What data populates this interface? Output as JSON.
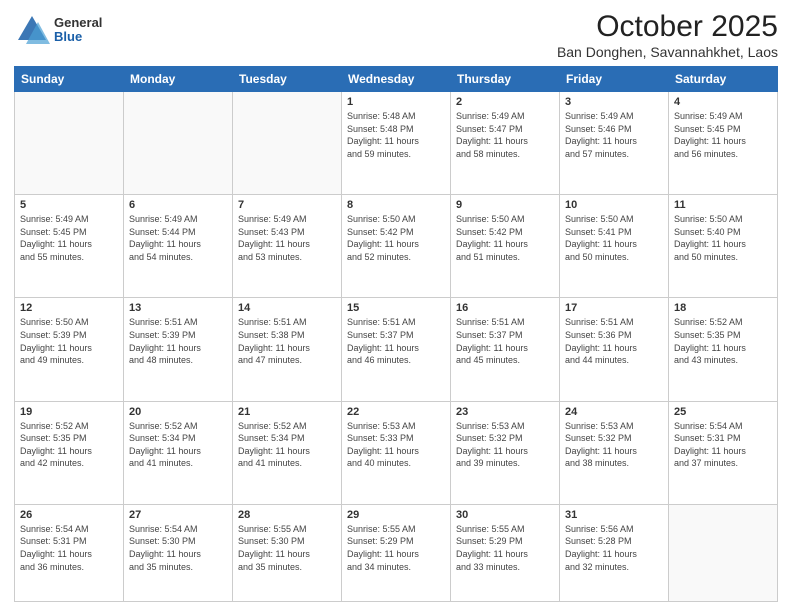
{
  "header": {
    "logo_general": "General",
    "logo_blue": "Blue",
    "title": "October 2025",
    "location": "Ban Donghen, Savannahkhet, Laos"
  },
  "weekdays": [
    "Sunday",
    "Monday",
    "Tuesday",
    "Wednesday",
    "Thursday",
    "Friday",
    "Saturday"
  ],
  "weeks": [
    [
      {
        "num": "",
        "info": ""
      },
      {
        "num": "",
        "info": ""
      },
      {
        "num": "",
        "info": ""
      },
      {
        "num": "1",
        "info": "Sunrise: 5:48 AM\nSunset: 5:48 PM\nDaylight: 11 hours\nand 59 minutes."
      },
      {
        "num": "2",
        "info": "Sunrise: 5:49 AM\nSunset: 5:47 PM\nDaylight: 11 hours\nand 58 minutes."
      },
      {
        "num": "3",
        "info": "Sunrise: 5:49 AM\nSunset: 5:46 PM\nDaylight: 11 hours\nand 57 minutes."
      },
      {
        "num": "4",
        "info": "Sunrise: 5:49 AM\nSunset: 5:45 PM\nDaylight: 11 hours\nand 56 minutes."
      }
    ],
    [
      {
        "num": "5",
        "info": "Sunrise: 5:49 AM\nSunset: 5:45 PM\nDaylight: 11 hours\nand 55 minutes."
      },
      {
        "num": "6",
        "info": "Sunrise: 5:49 AM\nSunset: 5:44 PM\nDaylight: 11 hours\nand 54 minutes."
      },
      {
        "num": "7",
        "info": "Sunrise: 5:49 AM\nSunset: 5:43 PM\nDaylight: 11 hours\nand 53 minutes."
      },
      {
        "num": "8",
        "info": "Sunrise: 5:50 AM\nSunset: 5:42 PM\nDaylight: 11 hours\nand 52 minutes."
      },
      {
        "num": "9",
        "info": "Sunrise: 5:50 AM\nSunset: 5:42 PM\nDaylight: 11 hours\nand 51 minutes."
      },
      {
        "num": "10",
        "info": "Sunrise: 5:50 AM\nSunset: 5:41 PM\nDaylight: 11 hours\nand 50 minutes."
      },
      {
        "num": "11",
        "info": "Sunrise: 5:50 AM\nSunset: 5:40 PM\nDaylight: 11 hours\nand 50 minutes."
      }
    ],
    [
      {
        "num": "12",
        "info": "Sunrise: 5:50 AM\nSunset: 5:39 PM\nDaylight: 11 hours\nand 49 minutes."
      },
      {
        "num": "13",
        "info": "Sunrise: 5:51 AM\nSunset: 5:39 PM\nDaylight: 11 hours\nand 48 minutes."
      },
      {
        "num": "14",
        "info": "Sunrise: 5:51 AM\nSunset: 5:38 PM\nDaylight: 11 hours\nand 47 minutes."
      },
      {
        "num": "15",
        "info": "Sunrise: 5:51 AM\nSunset: 5:37 PM\nDaylight: 11 hours\nand 46 minutes."
      },
      {
        "num": "16",
        "info": "Sunrise: 5:51 AM\nSunset: 5:37 PM\nDaylight: 11 hours\nand 45 minutes."
      },
      {
        "num": "17",
        "info": "Sunrise: 5:51 AM\nSunset: 5:36 PM\nDaylight: 11 hours\nand 44 minutes."
      },
      {
        "num": "18",
        "info": "Sunrise: 5:52 AM\nSunset: 5:35 PM\nDaylight: 11 hours\nand 43 minutes."
      }
    ],
    [
      {
        "num": "19",
        "info": "Sunrise: 5:52 AM\nSunset: 5:35 PM\nDaylight: 11 hours\nand 42 minutes."
      },
      {
        "num": "20",
        "info": "Sunrise: 5:52 AM\nSunset: 5:34 PM\nDaylight: 11 hours\nand 41 minutes."
      },
      {
        "num": "21",
        "info": "Sunrise: 5:52 AM\nSunset: 5:34 PM\nDaylight: 11 hours\nand 41 minutes."
      },
      {
        "num": "22",
        "info": "Sunrise: 5:53 AM\nSunset: 5:33 PM\nDaylight: 11 hours\nand 40 minutes."
      },
      {
        "num": "23",
        "info": "Sunrise: 5:53 AM\nSunset: 5:32 PM\nDaylight: 11 hours\nand 39 minutes."
      },
      {
        "num": "24",
        "info": "Sunrise: 5:53 AM\nSunset: 5:32 PM\nDaylight: 11 hours\nand 38 minutes."
      },
      {
        "num": "25",
        "info": "Sunrise: 5:54 AM\nSunset: 5:31 PM\nDaylight: 11 hours\nand 37 minutes."
      }
    ],
    [
      {
        "num": "26",
        "info": "Sunrise: 5:54 AM\nSunset: 5:31 PM\nDaylight: 11 hours\nand 36 minutes."
      },
      {
        "num": "27",
        "info": "Sunrise: 5:54 AM\nSunset: 5:30 PM\nDaylight: 11 hours\nand 35 minutes."
      },
      {
        "num": "28",
        "info": "Sunrise: 5:55 AM\nSunset: 5:30 PM\nDaylight: 11 hours\nand 35 minutes."
      },
      {
        "num": "29",
        "info": "Sunrise: 5:55 AM\nSunset: 5:29 PM\nDaylight: 11 hours\nand 34 minutes."
      },
      {
        "num": "30",
        "info": "Sunrise: 5:55 AM\nSunset: 5:29 PM\nDaylight: 11 hours\nand 33 minutes."
      },
      {
        "num": "31",
        "info": "Sunrise: 5:56 AM\nSunset: 5:28 PM\nDaylight: 11 hours\nand 32 minutes."
      },
      {
        "num": "",
        "info": ""
      }
    ]
  ]
}
